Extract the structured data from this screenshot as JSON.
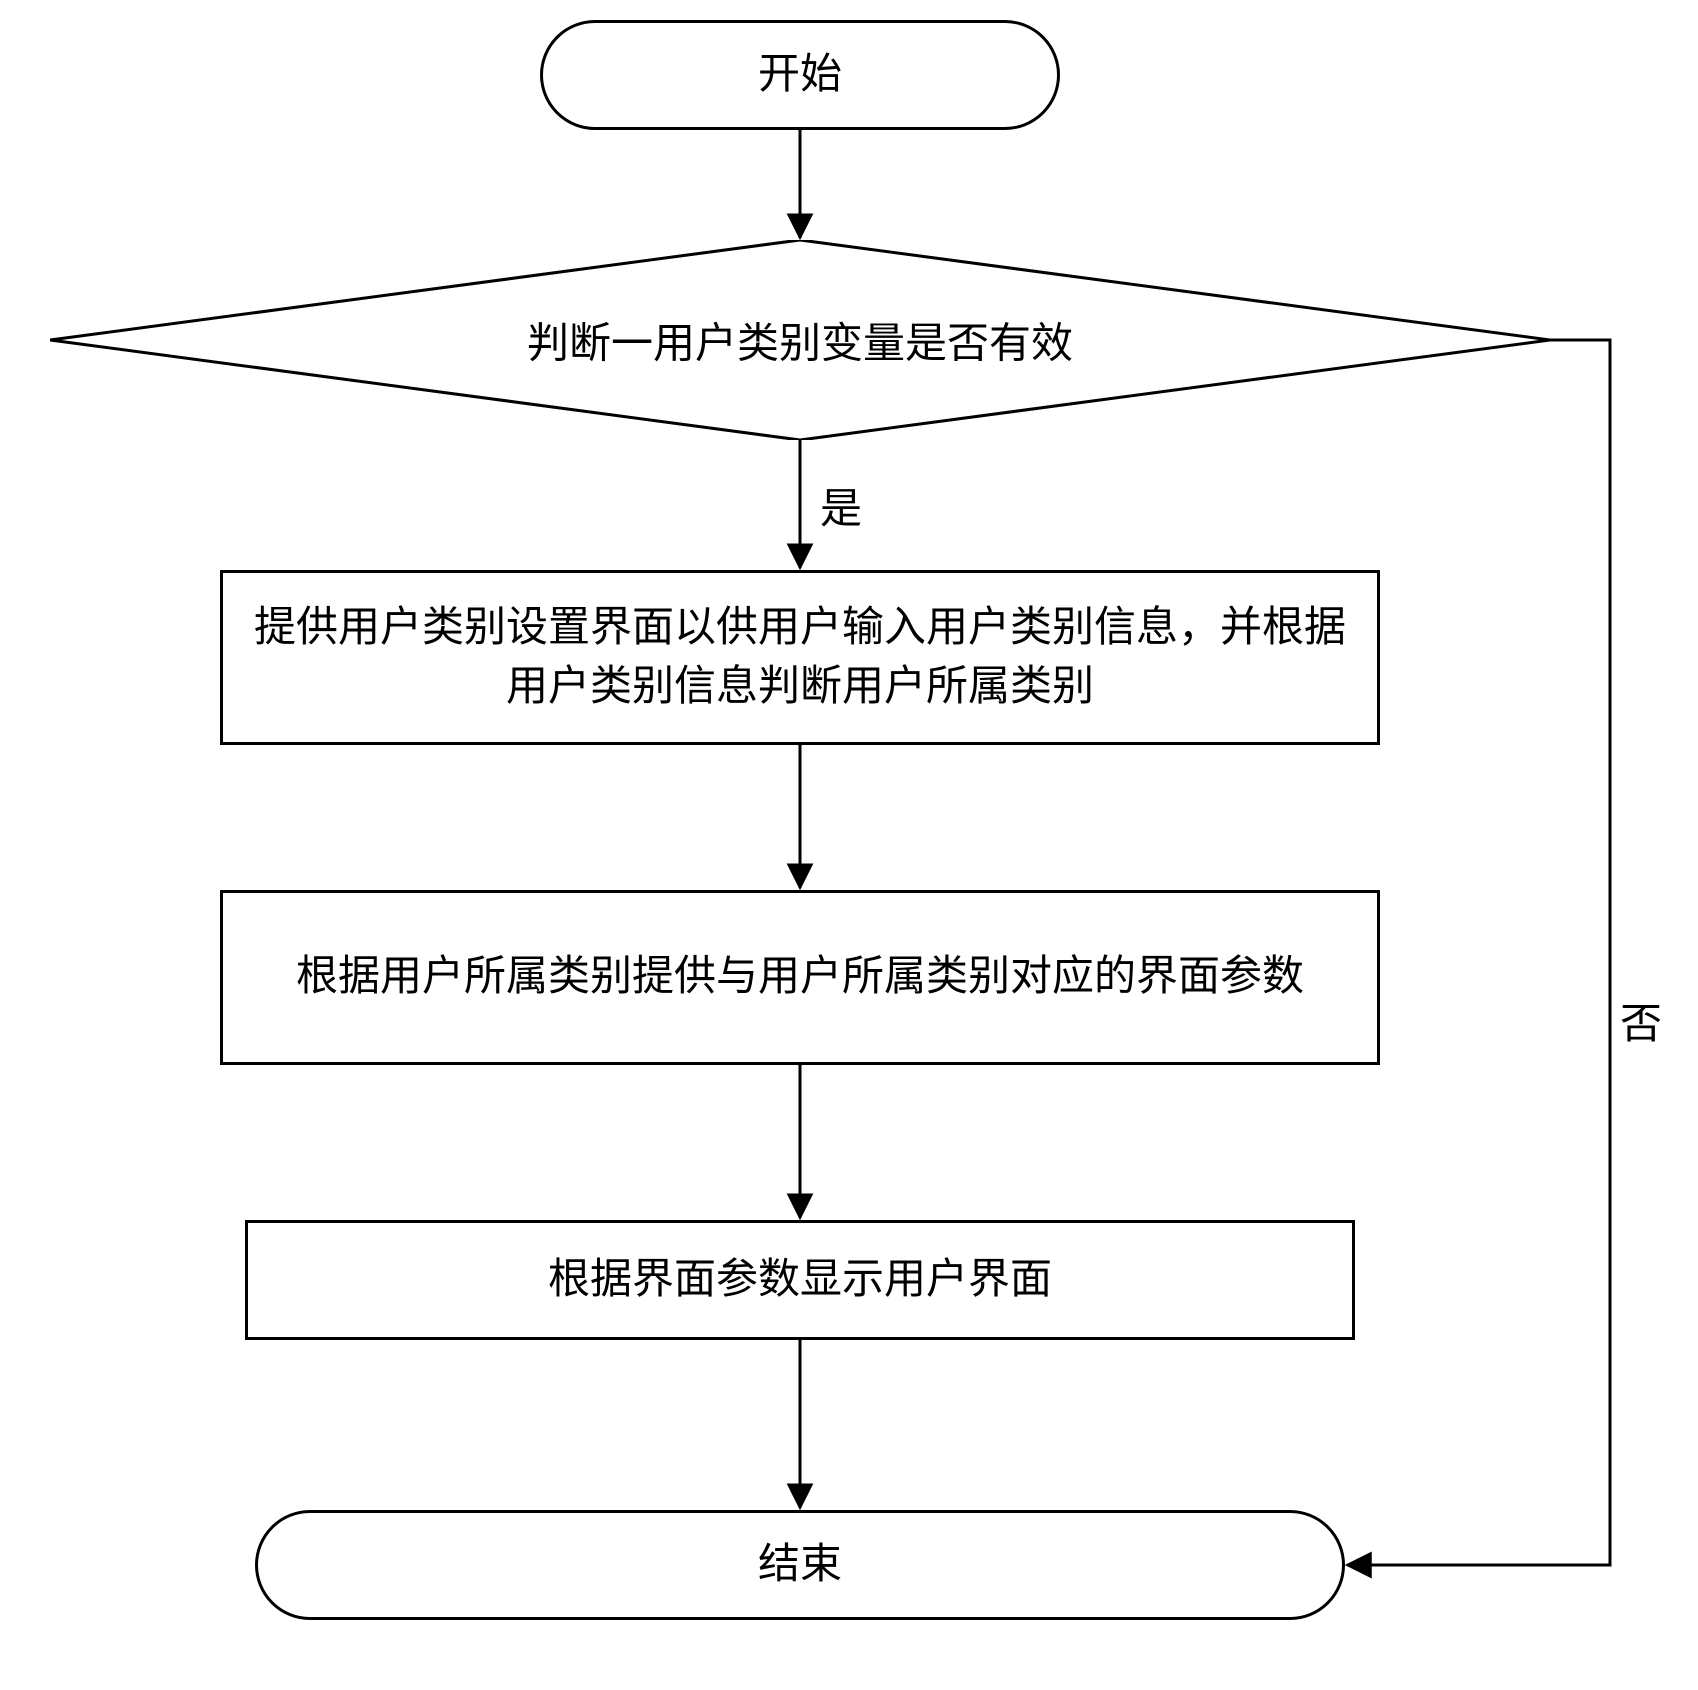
{
  "nodes": {
    "start": "开始",
    "decision": "判断一用户类别变量是否有效",
    "step1": "提供用户类别设置界面以供用户输入用户类别信息，并根据用户类别信息判断用户所属类别",
    "step2": "根据用户所属类别提供与用户所属类别对应的界面参数",
    "step3": "根据界面参数显示用户界面",
    "end": "结束"
  },
  "edges": {
    "yes": "是",
    "no": "否"
  }
}
